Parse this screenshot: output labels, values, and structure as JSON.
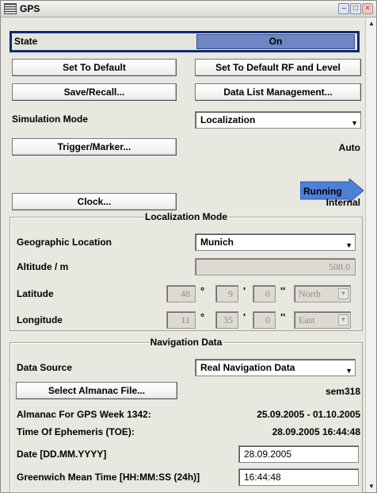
{
  "window": {
    "title": "GPS"
  },
  "state": {
    "label": "State",
    "value": "On"
  },
  "buttons": {
    "set_default": "Set To Default",
    "set_default_rf": "Set To Default RF and Level",
    "save_recall": "Save/Recall...",
    "data_list": "Data List Management...",
    "trigger_marker": "Trigger/Marker...",
    "clock": "Clock...",
    "select_almanac": "Select Almanac File..."
  },
  "simulation_mode": {
    "label": "Simulation Mode",
    "value": "Localization"
  },
  "trigger_status": "Auto",
  "running_label": "Running",
  "clock_status": "Internal",
  "localization": {
    "title": "Localization Mode",
    "geo_label": "Geographic Location",
    "geo_value": "Munich",
    "altitude_label": "Altitude / m",
    "altitude_value": "508.0",
    "latitude_label": "Latitude",
    "lat_deg": "48",
    "lat_min": "9",
    "lat_sec": "0",
    "lat_dir": "North",
    "longitude_label": "Longitude",
    "lon_deg": "11",
    "lon_min": "35",
    "lon_sec": "0",
    "lon_dir": "East"
  },
  "navigation": {
    "title": "Navigation Data",
    "source_label": "Data Source",
    "source_value": "Real Navigation Data",
    "almanac_file": "sem318",
    "almanac_week_label": "Almanac For GPS Week 1342:",
    "almanac_week_value": "25.09.2005 - 01.10.2005",
    "toe_label": "Time Of Ephemeris (TOE):",
    "toe_value": "28.09.2005 16:44:48",
    "date_label": "Date [DD.MM.YYYY]",
    "date_value": "28.09.2005",
    "gmt_label": "Greenwich Mean Time [HH:MM:SS (24h)]",
    "gmt_value": "16:44:48"
  },
  "colors": {
    "state_border": "#0d2a75",
    "state_on": "#6d87c4",
    "running_arrow": "#4f7fd6"
  }
}
